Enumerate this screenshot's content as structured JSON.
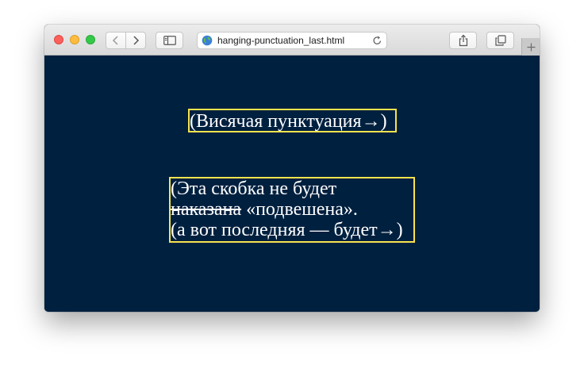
{
  "browser": {
    "url": "hanging-punctuation_last.html"
  },
  "toolbar_icons": {
    "back": "chevron-left-icon",
    "forward": "chevron-right-icon",
    "sidebar": "sidebar-icon",
    "share": "share-icon",
    "tabs": "tabs-icon",
    "reload": "reload-icon",
    "new_tab": "plus-icon",
    "site": "globe-icon"
  },
  "colors": {
    "page_background": "#00203f",
    "box_border": "#f7e34d",
    "text": "#ffffff"
  },
  "content": {
    "box1": {
      "text": "(Висячая пунктуация→",
      "hanging_close": ")"
    },
    "box2": {
      "line1": "(Эта скобка не будет",
      "line2_struck": "наказана",
      "line2_rest": " «подвешена».",
      "line3": "(а вот последняя — будет→",
      "hanging_close": ")"
    }
  }
}
